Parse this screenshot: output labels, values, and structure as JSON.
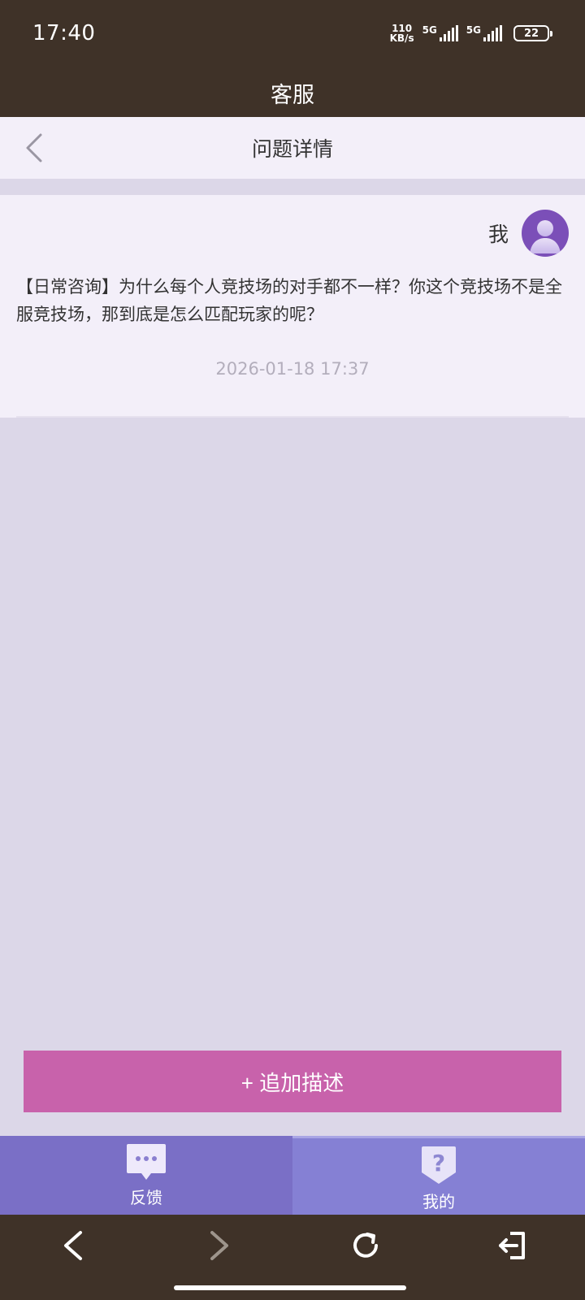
{
  "status_bar": {
    "time": "17:40",
    "net_speed_value": "110",
    "net_speed_unit": "KB/s",
    "signal_1": "5G",
    "signal_2": "5G",
    "battery": "22"
  },
  "header": {
    "title": "客服"
  },
  "sub_header": {
    "title": "问题详情",
    "back_icon": "chevron-left-icon"
  },
  "message": {
    "sender": "我",
    "text": "【日常咨询】为什么每个人竞技场的对手都不一样？你这个竞技场不是全服竞技场，那到底是怎么匹配玩家的呢？",
    "timestamp": "2026-01-18 17:37"
  },
  "actions": {
    "add_description": "+ 追加描述"
  },
  "tabs": [
    {
      "label": "反馈",
      "icon": "chat-bubble-icon",
      "active": false
    },
    {
      "label": "我的",
      "icon": "question-icon",
      "active": true
    }
  ],
  "nav": {
    "back_icon": "arrow-left-icon",
    "forward_icon": "arrow-right-icon",
    "refresh_icon": "refresh-icon",
    "exit_icon": "exit-icon"
  },
  "colors": {
    "header_bg": "#3f3228",
    "page_bg": "#dcd7e8",
    "card_bg": "#f3eff9",
    "accent_button": "#c862ab",
    "tab_bg": "#7a6fc6",
    "avatar": "#7b4fb8"
  }
}
